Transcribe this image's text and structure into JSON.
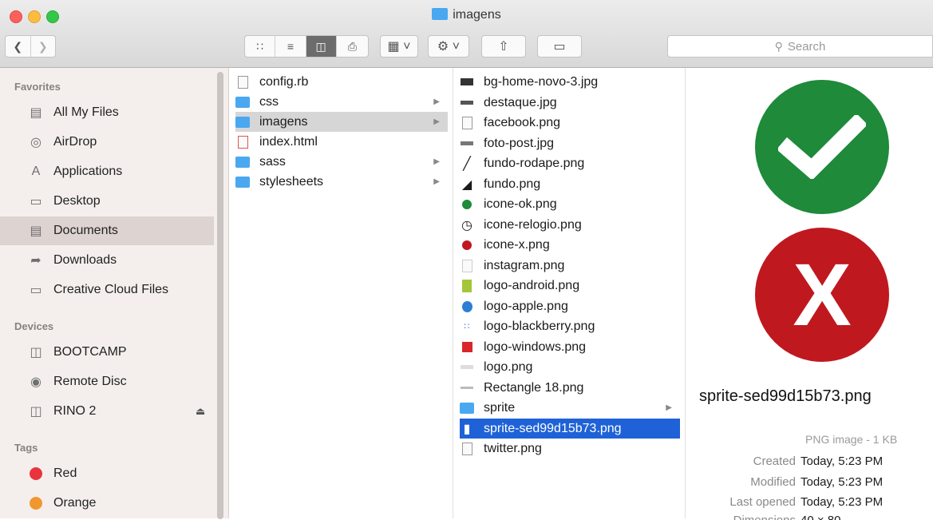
{
  "window": {
    "title": "imagens"
  },
  "toolbar": {
    "search_placeholder": "Search"
  },
  "sidebar": {
    "favorites_header": "Favorites",
    "favorites": [
      {
        "label": "All My Files",
        "icon": "all-files-icon"
      },
      {
        "label": "AirDrop",
        "icon": "airdrop-icon"
      },
      {
        "label": "Applications",
        "icon": "applications-icon"
      },
      {
        "label": "Desktop",
        "icon": "desktop-icon"
      },
      {
        "label": "Documents",
        "icon": "documents-icon",
        "selected": true
      },
      {
        "label": "Downloads",
        "icon": "downloads-icon"
      },
      {
        "label": "Creative Cloud Files",
        "icon": "folder-icon"
      }
    ],
    "devices_header": "Devices",
    "devices": [
      {
        "label": "BOOTCAMP",
        "icon": "disk-icon"
      },
      {
        "label": "Remote Disc",
        "icon": "disc-icon"
      },
      {
        "label": "RINO 2",
        "icon": "disk-icon",
        "eject": true
      }
    ],
    "tags_header": "Tags",
    "tags": [
      {
        "label": "Red",
        "color": "#e8343f"
      },
      {
        "label": "Orange",
        "color": "#f0972f"
      }
    ]
  },
  "column1": [
    {
      "name": "config.rb",
      "type": "file"
    },
    {
      "name": "css",
      "type": "folder"
    },
    {
      "name": "imagens",
      "type": "folder",
      "selected": true
    },
    {
      "name": "index.html",
      "type": "file"
    },
    {
      "name": "sass",
      "type": "folder"
    },
    {
      "name": "stylesheets",
      "type": "folder"
    }
  ],
  "column2": [
    {
      "name": "bg-home-novo-3.jpg"
    },
    {
      "name": "destaque.jpg"
    },
    {
      "name": "facebook.png"
    },
    {
      "name": "foto-post.jpg"
    },
    {
      "name": "fundo-rodape.png"
    },
    {
      "name": "fundo.png"
    },
    {
      "name": "icone-ok.png"
    },
    {
      "name": "icone-relogio.png"
    },
    {
      "name": "icone-x.png"
    },
    {
      "name": "instagram.png"
    },
    {
      "name": "logo-android.png"
    },
    {
      "name": "logo-apple.png"
    },
    {
      "name": "logo-blackberry.png"
    },
    {
      "name": "logo-windows.png"
    },
    {
      "name": "logo.png"
    },
    {
      "name": "Rectangle 18.png"
    },
    {
      "name": "sprite",
      "type": "folder"
    },
    {
      "name": "sprite-sed99d15b73.png",
      "selected": true
    },
    {
      "name": "twitter.png"
    }
  ],
  "preview": {
    "filename": "sprite-sed99d15b73.png",
    "kind": "PNG image - 1 KB",
    "check_color": "#1e8a3a",
    "x_color": "#c0181f",
    "x_glyph": "X",
    "meta": [
      {
        "key": "Created",
        "value": "Today, 5:23 PM"
      },
      {
        "key": "Modified",
        "value": "Today, 5:23 PM"
      },
      {
        "key": "Last opened",
        "value": "Today, 5:23 PM"
      },
      {
        "key": "Dimensions",
        "value": "40 × 80"
      }
    ]
  }
}
